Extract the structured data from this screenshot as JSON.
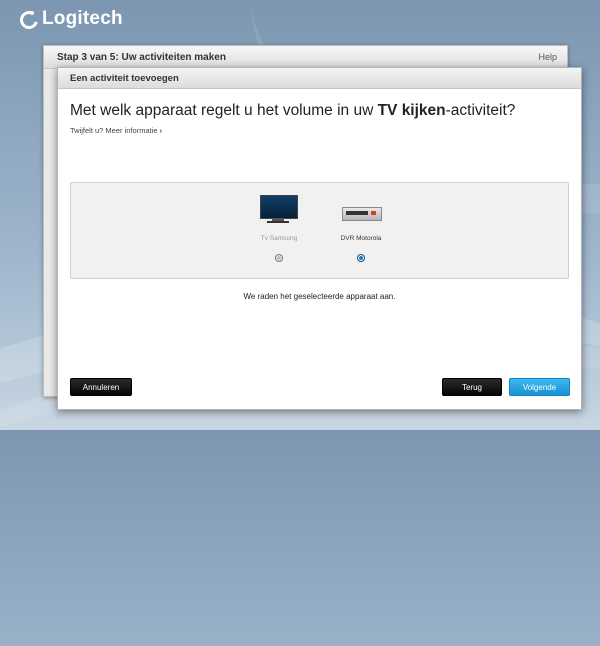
{
  "brand": {
    "name": "Logitech"
  },
  "wizard": {
    "step_title": "Stap 3 van 5: Uw activiteiten maken",
    "help_label": "Help"
  },
  "dialog": {
    "title": "Een activiteit toevoegen",
    "question_prefix": "Met welk apparaat regelt u het volume in uw ",
    "question_bold": "TV kijken",
    "question_suffix": "-activiteit?",
    "info_link": "Twijfelt u? Meer informatie",
    "info_chevron": "›",
    "devices": [
      {
        "name": "Tv Samsung",
        "icon": "tv-icon",
        "selected": false
      },
      {
        "name": "DVR Motorola",
        "icon": "dvr-icon",
        "selected": true
      }
    ],
    "hint": "We raden het geselecteerde apparaat aan.",
    "buttons": {
      "cancel": "Annuleren",
      "back": "Terug",
      "next": "Volgende"
    }
  },
  "colors": {
    "primary_button": "#23a3e3",
    "dark_button": "#111111",
    "background": "#8ea7bf"
  }
}
